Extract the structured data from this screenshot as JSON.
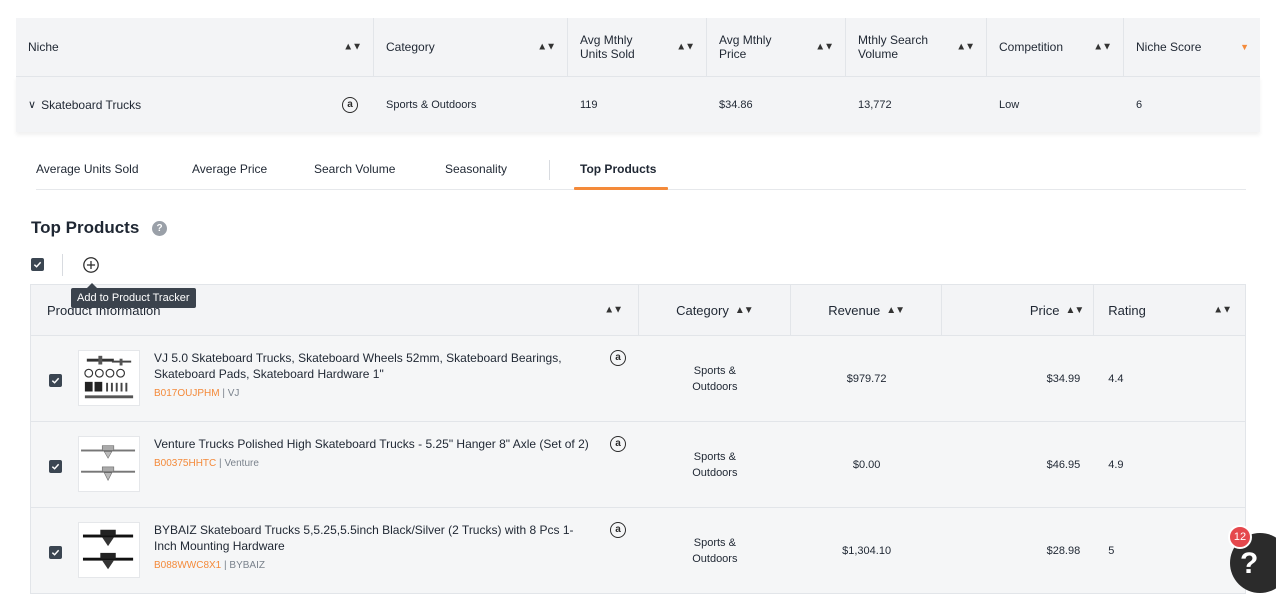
{
  "niche_table": {
    "headers": [
      "Niche",
      "Category",
      "Avg Mthly Units Sold",
      "Avg Mthly Price",
      "Mthly Search Volume",
      "Competition",
      "Niche Score"
    ],
    "header_lines": {
      "units": [
        "Avg Mthly",
        "Units Sold"
      ],
      "price": [
        "Avg Mthly",
        "Price"
      ],
      "search": [
        "Mthly Search",
        "Volume"
      ]
    },
    "row": {
      "niche": "Skateboard Trucks",
      "category": "Sports & Outdoors",
      "units_sold": "119",
      "price": "$34.86",
      "search_volume": "13,772",
      "competition": "Low",
      "niche_score": "6"
    }
  },
  "tabs": [
    {
      "label": "Average Units Sold",
      "active": false
    },
    {
      "label": "Average Price",
      "active": false
    },
    {
      "label": "Search Volume",
      "active": false
    },
    {
      "label": "Seasonality",
      "active": false
    },
    {
      "label": "Top Products",
      "active": true
    }
  ],
  "top_products": {
    "title": "Top Products",
    "tooltip": "Add to Product Tracker",
    "columns": {
      "product_info": "Product Information",
      "category": "Category",
      "revenue": "Revenue",
      "price": "Price",
      "rating": "Rating"
    },
    "rows": [
      {
        "title": "VJ 5.0 Skateboard Trucks, Skateboard Wheels 52mm, Skateboard Bearings, Skateboard Pads, Skateboard Hardware 1\"",
        "asin": "B017OUJPHM",
        "brand": "VJ",
        "category_line1": "Sports &",
        "category_line2": "Outdoors",
        "revenue": "$979.72",
        "price": "$34.99",
        "rating": "4.4"
      },
      {
        "title": "Venture Trucks Polished High Skateboard Trucks - 5.25\" Hanger 8\" Axle (Set of 2)",
        "asin": "B00375HHTC",
        "brand": "Venture",
        "category_line1": "Sports &",
        "category_line2": "Outdoors",
        "revenue": "$0.00",
        "price": "$46.95",
        "rating": "4.9"
      },
      {
        "title": "BYBAIZ Skateboard Trucks 5,5.25,5.5inch Black/Silver (2 Trucks) with 8 Pcs 1-Inch Mounting Hardware",
        "asin": "B088WWC8X1",
        "brand": "BYBAIZ",
        "category_line1": "Sports &",
        "category_line2": "Outdoors",
        "revenue": "$1,304.10",
        "price": "$28.98",
        "rating": "5"
      }
    ]
  },
  "widget": {
    "notification_count": "12",
    "help_glyph": "?"
  },
  "colors": {
    "accent": "#f48a3a",
    "header_bg": "#f3f4f6",
    "checkbox": "#3b4652",
    "badge": "#e5484d"
  }
}
